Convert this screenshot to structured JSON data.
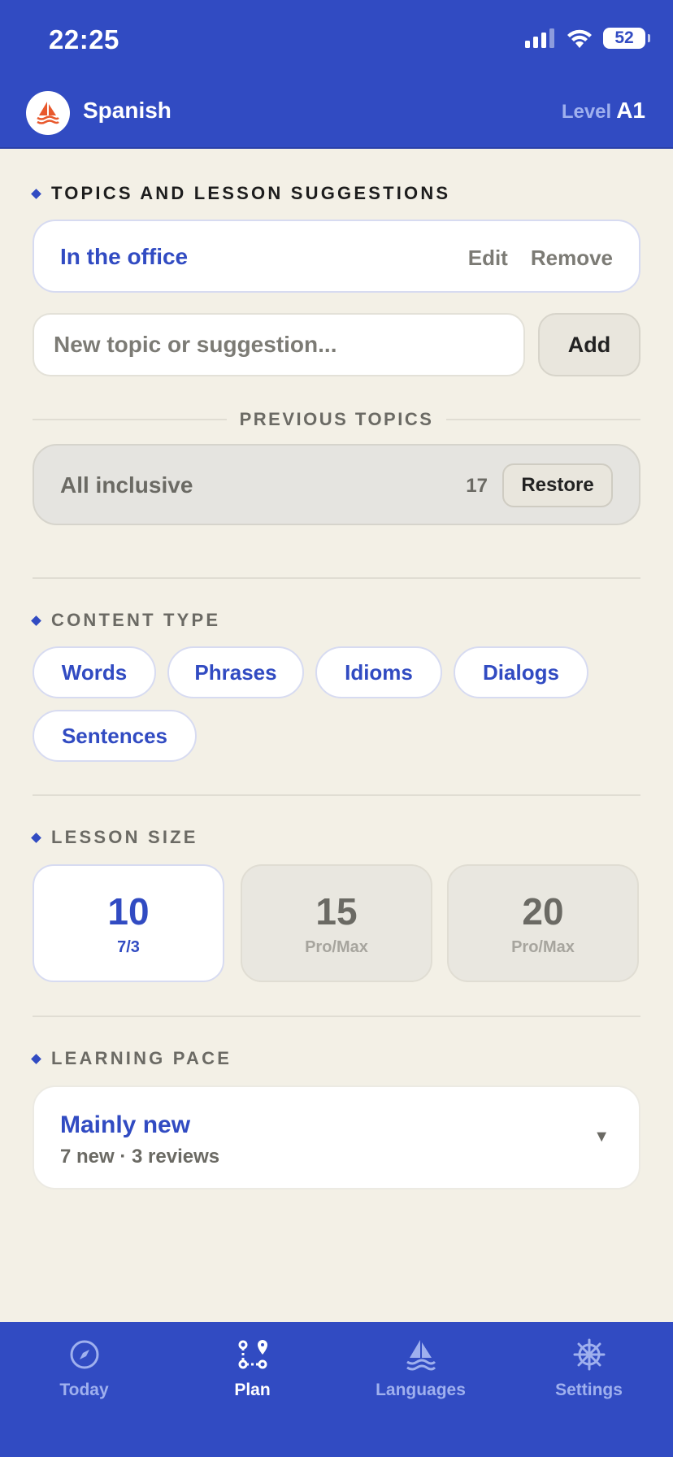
{
  "status": {
    "time": "22:25",
    "battery": "52"
  },
  "header": {
    "title": "Spanish",
    "level_label": "Level",
    "level_value": "A1"
  },
  "topics": {
    "section_title": "TOPICS AND LESSON SUGGESTIONS",
    "current": {
      "name": "In the office",
      "edit_label": "Edit",
      "remove_label": "Remove"
    },
    "input_placeholder": "New topic or suggestion...",
    "add_label": "Add",
    "previous_label": "PREVIOUS TOPICS",
    "previous": [
      {
        "name": "All inclusive",
        "count": "17",
        "restore_label": "Restore"
      }
    ]
  },
  "content_type": {
    "section_title": "CONTENT TYPE",
    "options": [
      "Words",
      "Phrases",
      "Idioms",
      "Dialogs",
      "Sentences"
    ]
  },
  "lesson_size": {
    "section_title": "LESSON SIZE",
    "options": [
      {
        "value": "10",
        "sub": "7/3"
      },
      {
        "value": "15",
        "sub": "Pro/Max"
      },
      {
        "value": "20",
        "sub": "Pro/Max"
      }
    ]
  },
  "learning_pace": {
    "section_title": "LEARNING PACE",
    "selected": "Mainly new",
    "detail": "7 new · 3 reviews",
    "caret": "▼"
  },
  "tabs": [
    {
      "label": "Today",
      "icon": "compass-icon"
    },
    {
      "label": "Plan",
      "icon": "route-icon"
    },
    {
      "label": "Languages",
      "icon": "sailboat-icon"
    },
    {
      "label": "Settings",
      "icon": "ship-wheel-icon"
    }
  ],
  "colors": {
    "brand": "#314bc2",
    "background": "#f3f0e6",
    "logo_accent": "#e8582c"
  }
}
